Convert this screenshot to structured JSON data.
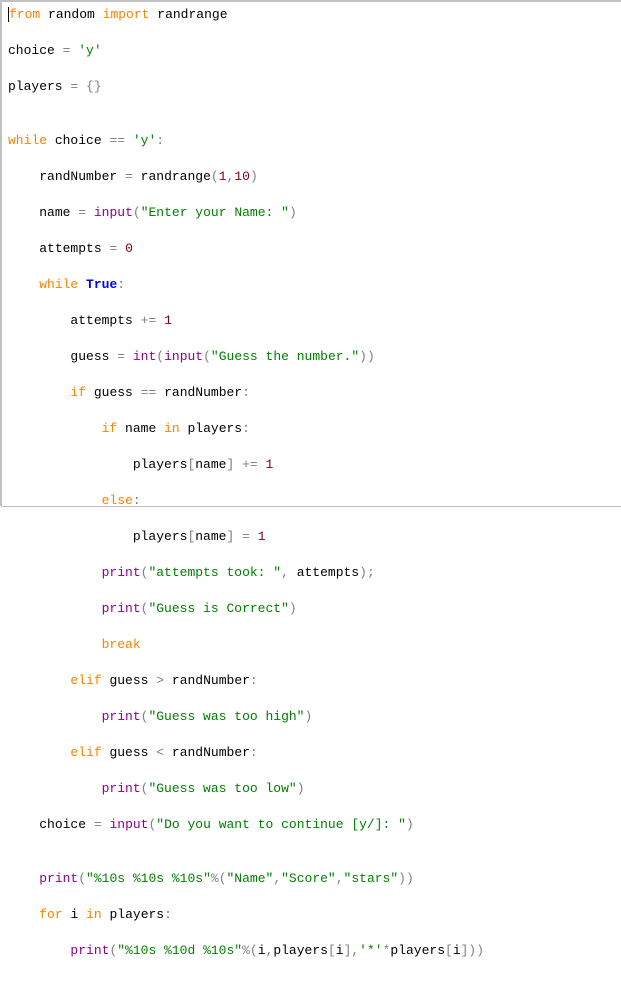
{
  "code": {
    "l1": {
      "kw1": "from",
      "mod": "random",
      "kw2": "import",
      "fn": "randrange"
    },
    "l2": {
      "var": "choice",
      "op": "=",
      "str": "'y'"
    },
    "l3": {
      "var": "players",
      "op": "=",
      "brace": "{}"
    },
    "l4": "",
    "l5": {
      "kw": "while",
      "var": "choice",
      "op": "==",
      "str": "'y'",
      "colon": ":"
    },
    "l6": {
      "var": "randNumber",
      "op": "=",
      "fn": "randrange",
      "args": "(1,10)",
      "n1": "1",
      "n2": "10"
    },
    "l7": {
      "var": "name",
      "op": "=",
      "fn": "input",
      "str": "\"Enter your Name: \""
    },
    "l8": {
      "var": "attempts",
      "op": "=",
      "num": "0"
    },
    "l9": {
      "kw": "while",
      "val": "True",
      "colon": ":"
    },
    "l10": {
      "var": "attempts",
      "op": "+=",
      "num": "1"
    },
    "l11": {
      "var": "guess",
      "op": "=",
      "cast": "int",
      "fn": "input",
      "str": "\"Guess the number.\""
    },
    "l12": {
      "kw": "if",
      "var1": "guess",
      "op": "==",
      "var2": "randNumber",
      "colon": ":"
    },
    "l13": {
      "kw1": "if",
      "var1": "name",
      "kw2": "in",
      "var2": "players",
      "colon": ":"
    },
    "l14": {
      "var": "players[name]",
      "v1": "players",
      "v2": "name",
      "op": "+=",
      "num": "1"
    },
    "l15": {
      "kw": "else",
      "colon": ":"
    },
    "l16": {
      "var": "players[name]",
      "v1": "players",
      "v2": "name",
      "op": "=",
      "num": "1"
    },
    "l17": {
      "fn": "print",
      "str": "\"attempts took: \"",
      "var": "attempts",
      "semi": ";"
    },
    "l18": {
      "fn": "print",
      "str": "\"Guess is Correct\""
    },
    "l19": {
      "kw": "break"
    },
    "l20": {
      "kw": "elif",
      "var1": "guess",
      "op": ">",
      "var2": "randNumber",
      "colon": ":"
    },
    "l21": {
      "fn": "print",
      "str": "\"Guess was too high\""
    },
    "l22": {
      "kw": "elif",
      "var1": "guess",
      "op": "<",
      "var2": "randNumber",
      "colon": ":"
    },
    "l23": {
      "fn": "print",
      "str": "\"Guess was too low\""
    },
    "l24": {
      "var": "choice",
      "op": "=",
      "fn": "input",
      "str": "\"Do you want to continue [y/]: \""
    },
    "l25": "",
    "l26": {
      "fn": "print",
      "str": "\"%10s %10s %10s\"",
      "op": "%",
      "s1": "\"Name\"",
      "s2": "\"Score\"",
      "s3": "\"stars\""
    },
    "l27": {
      "kw1": "for",
      "var": "i",
      "kw2": "in",
      "iter": "players",
      "colon": ":"
    },
    "l28": {
      "fn": "print",
      "str": "\"%10s %10d %10s\"",
      "op": "%",
      "v1": "i",
      "v2": "players",
      "v3": "i",
      "ch": "'*'",
      "op2": "*",
      "v4": "players",
      "v5": "i"
    }
  }
}
